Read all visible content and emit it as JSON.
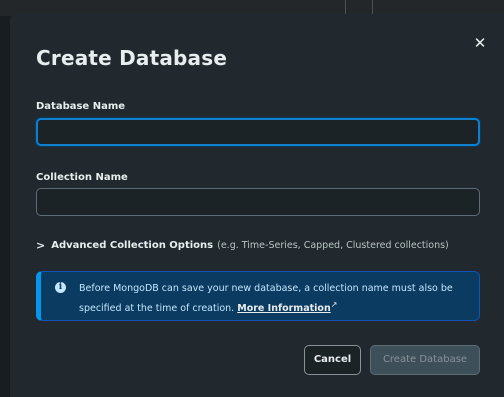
{
  "dialog": {
    "title": "Create Database",
    "close_icon": "close-icon",
    "database_name": {
      "label": "Database Name",
      "value": ""
    },
    "collection_name": {
      "label": "Collection Name",
      "value": ""
    },
    "advanced": {
      "label": "Advanced Collection Options",
      "hint": "(e.g. Time-Series, Capped, Clustered collections)"
    },
    "banner": {
      "text": "Before MongoDB can save your new database, a collection name must also be specified at the time of creation.",
      "link": "More Information"
    },
    "buttons": {
      "cancel": "Cancel",
      "create": "Create Database"
    }
  },
  "colors": {
    "modal_bg": "#21292f",
    "focus_border": "#0f7fd0",
    "banner_bg": "#0b3b60",
    "banner_accent": "#0498ec"
  }
}
